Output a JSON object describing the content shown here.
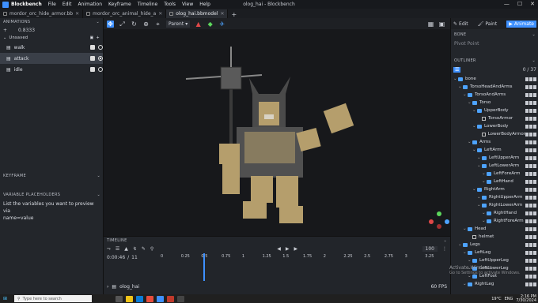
{
  "app": {
    "name": "Blockbench",
    "window_title": "olog_hai - Blockbench"
  },
  "menu": [
    "File",
    "Edit",
    "Animation",
    "Keyframe",
    "Timeline",
    "Tools",
    "View",
    "Help"
  ],
  "tabs": [
    {
      "label": "mordor_orc_hide_armor.bb",
      "active": false
    },
    {
      "label": "mordor_orc_animal_hide_a",
      "active": false
    },
    {
      "label": "olog_hai.bbmodel",
      "active": true
    }
  ],
  "left": {
    "animations_header": "ANIMATIONS",
    "anim_length": "0.8333",
    "group_label": "Unsaved",
    "animations": [
      {
        "name": "walk",
        "selected": false
      },
      {
        "name": "attack",
        "selected": true
      },
      {
        "name": "idle",
        "selected": false
      }
    ],
    "keyframe_header": "KEYFRAME",
    "placeholders_header": "VARIABLE PLACEHOLDERS",
    "placeholders_hint": "List the variables you want to preview via",
    "placeholders_value": "name=value"
  },
  "viewport": {
    "pivot_mode": "Parent"
  },
  "timeline": {
    "header": "TIMELINE",
    "time": "0:00:46",
    "frame": "11",
    "speed": "100",
    "ticks": [
      "0",
      "0.25",
      "0.5",
      "0.75",
      "1",
      "1.25",
      "1.5",
      "1.75",
      "2",
      "2.25",
      "2.5",
      "2.75",
      "3",
      "3.25"
    ],
    "playhead_time": 0.5,
    "track_name": "olog_hai",
    "fps": "60 FPS"
  },
  "right": {
    "modes": [
      {
        "label": "Edit",
        "active": false
      },
      {
        "label": "Paint",
        "active": false
      },
      {
        "label": "Animate",
        "active": true
      }
    ],
    "bone_header": "BONE",
    "pivot_point": "Pivot Point",
    "outliner_header": "OUTLINER",
    "outliner_count": "0 / 37",
    "outliner": [
      {
        "label": "bone",
        "depth": 0,
        "type": "folder"
      },
      {
        "label": "TorsoHeadAndArms",
        "depth": 1,
        "type": "folder"
      },
      {
        "label": "TorsoAndArms",
        "depth": 2,
        "type": "folder"
      },
      {
        "label": "Torso",
        "depth": 3,
        "type": "folder"
      },
      {
        "label": "UpperBody",
        "depth": 4,
        "type": "folder"
      },
      {
        "label": "TorsoArmor",
        "depth": 5,
        "type": "cube"
      },
      {
        "label": "LowerBody",
        "depth": 4,
        "type": "folder"
      },
      {
        "label": "LowerBodyArmor",
        "depth": 5,
        "type": "cube"
      },
      {
        "label": "Arms",
        "depth": 3,
        "type": "folder"
      },
      {
        "label": "LeftArm",
        "depth": 4,
        "type": "folder"
      },
      {
        "label": "LeftUpperArm",
        "depth": 5,
        "type": "folder"
      },
      {
        "label": "LeftLowerArm",
        "depth": 5,
        "type": "folder"
      },
      {
        "label": "LeftForeArm",
        "depth": 6,
        "type": "folder"
      },
      {
        "label": "LeftHand",
        "depth": 6,
        "type": "folder"
      },
      {
        "label": "RightArm",
        "depth": 4,
        "type": "folder"
      },
      {
        "label": "RightUpperArm",
        "depth": 5,
        "type": "folder"
      },
      {
        "label": "RightLowerArm",
        "depth": 5,
        "type": "folder"
      },
      {
        "label": "RightHand",
        "depth": 6,
        "type": "folder"
      },
      {
        "label": "RightForeArm",
        "depth": 6,
        "type": "folder"
      },
      {
        "label": "Head",
        "depth": 2,
        "type": "folder"
      },
      {
        "label": "helmet",
        "depth": 3,
        "type": "cube"
      },
      {
        "label": "Legs",
        "depth": 1,
        "type": "folder"
      },
      {
        "label": "LeftLeg",
        "depth": 2,
        "type": "folder"
      },
      {
        "label": "LeftUpperLeg",
        "depth": 3,
        "type": "folder"
      },
      {
        "label": "LeftLowerLeg",
        "depth": 3,
        "type": "folder"
      },
      {
        "label": "LeftFoot",
        "depth": 3,
        "type": "folder"
      },
      {
        "label": "RightLeg",
        "depth": 2,
        "type": "folder"
      }
    ]
  },
  "watermark": {
    "line1": "Activate Windows",
    "line2": "Go to Settings to activate Windows."
  },
  "taskbar": {
    "search_placeholder": "Type here to search",
    "weather": "19°C",
    "lang": "ENG",
    "clock": "2:16 PM",
    "date": "7/30/2024"
  },
  "colors": {
    "accent": "#3e90ff",
    "skin": "#b59e6c",
    "armor": "#4a4a4a"
  }
}
